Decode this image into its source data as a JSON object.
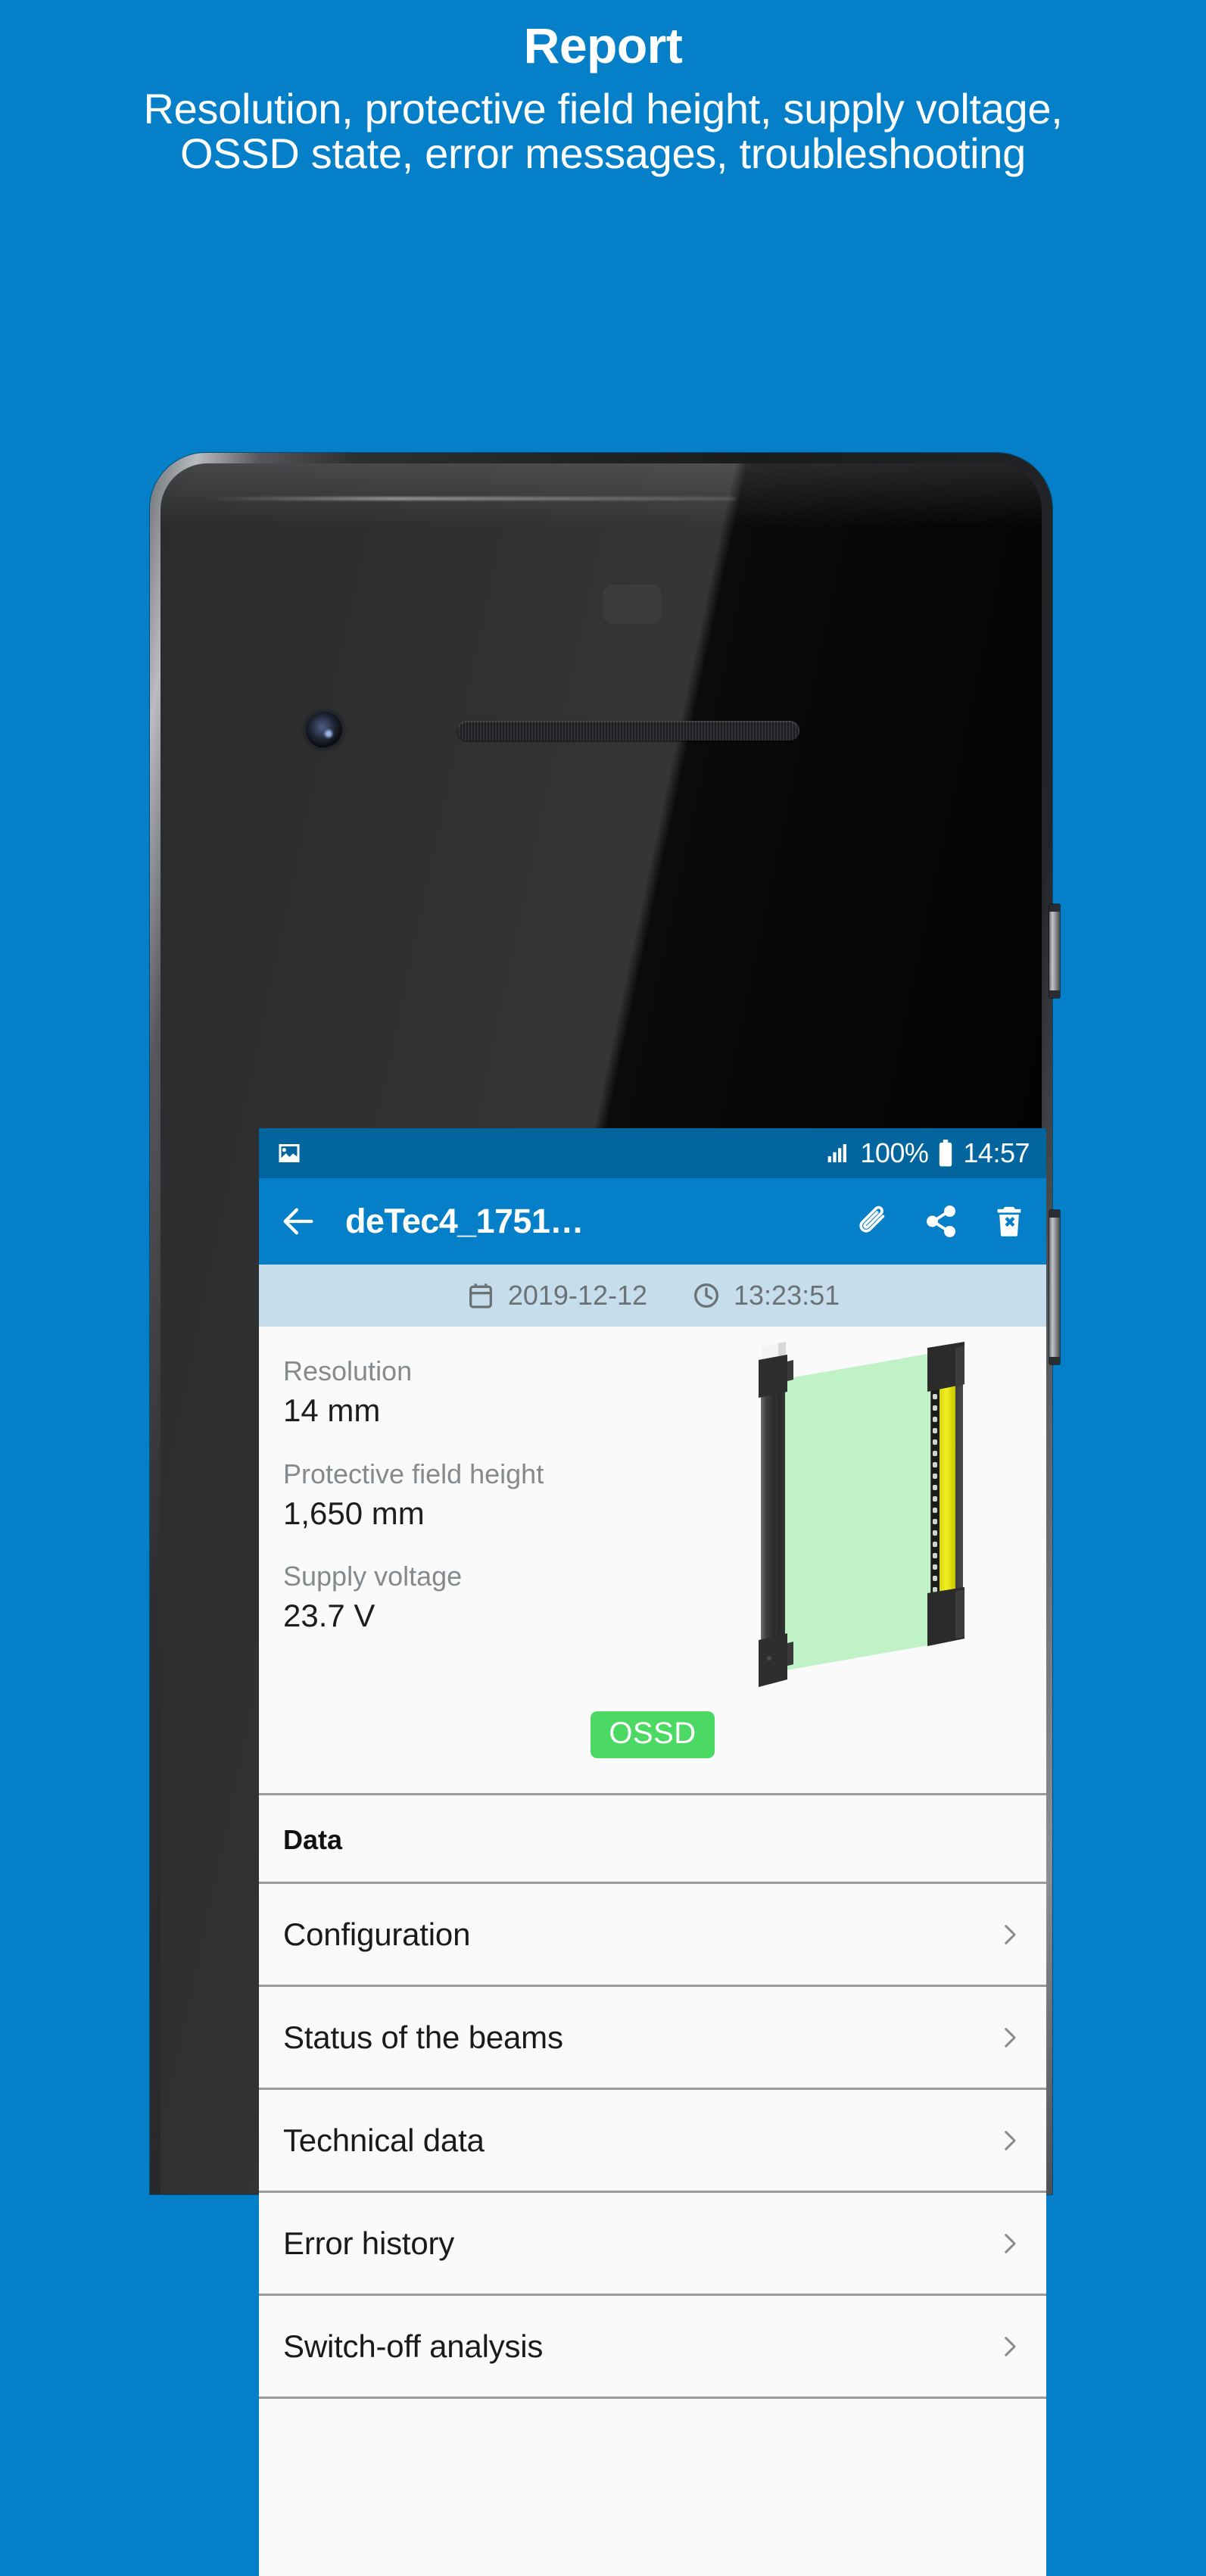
{
  "promo": {
    "title": "Report",
    "subtitle": "Resolution, protective field height, supply voltage, OSSD state, error messages, troubleshooting"
  },
  "colors": {
    "background": "#0580C8",
    "status_bar": "#03659E",
    "app_bar": "#0580C8",
    "date_bar": "#C6DEEC",
    "ossd_badge": "#4BD964",
    "screen": "#FAFAFA"
  },
  "phone": {
    "status_bar": {
      "notification_icon": "image-icon",
      "signal_icon": "signal-bars-icon",
      "battery_percent": "100%",
      "battery_icon": "battery-full-icon",
      "time": "14:57"
    },
    "app_bar": {
      "back_icon": "arrow-left-icon",
      "title": "deTec4_1751…",
      "actions": [
        {
          "name": "attach-icon",
          "label": "Attach"
        },
        {
          "name": "share-icon",
          "label": "Share"
        },
        {
          "name": "delete-icon",
          "label": "Delete"
        }
      ]
    },
    "date_bar": {
      "calendar_icon": "calendar-icon",
      "date": "2019-12-12",
      "clock_icon": "clock-icon",
      "time": "13:23:51"
    },
    "summary": {
      "fields": [
        {
          "label": "Resolution",
          "value": "14 mm"
        },
        {
          "label": "Protective field height",
          "value": "1,650 mm"
        },
        {
          "label": "Supply voltage",
          "value": "23.7 V"
        }
      ],
      "product_image": "light-curtain-illustration",
      "ossd_badge": "OSSD"
    },
    "list": {
      "header": "Data",
      "items": [
        {
          "label": "Configuration",
          "chevron": "chevron-right-icon"
        },
        {
          "label": "Status of the beams",
          "chevron": "chevron-right-icon"
        },
        {
          "label": "Technical data",
          "chevron": "chevron-right-icon"
        },
        {
          "label": "Error history",
          "chevron": "chevron-right-icon"
        },
        {
          "label": "Switch-off analysis",
          "chevron": "chevron-right-icon"
        }
      ]
    }
  }
}
